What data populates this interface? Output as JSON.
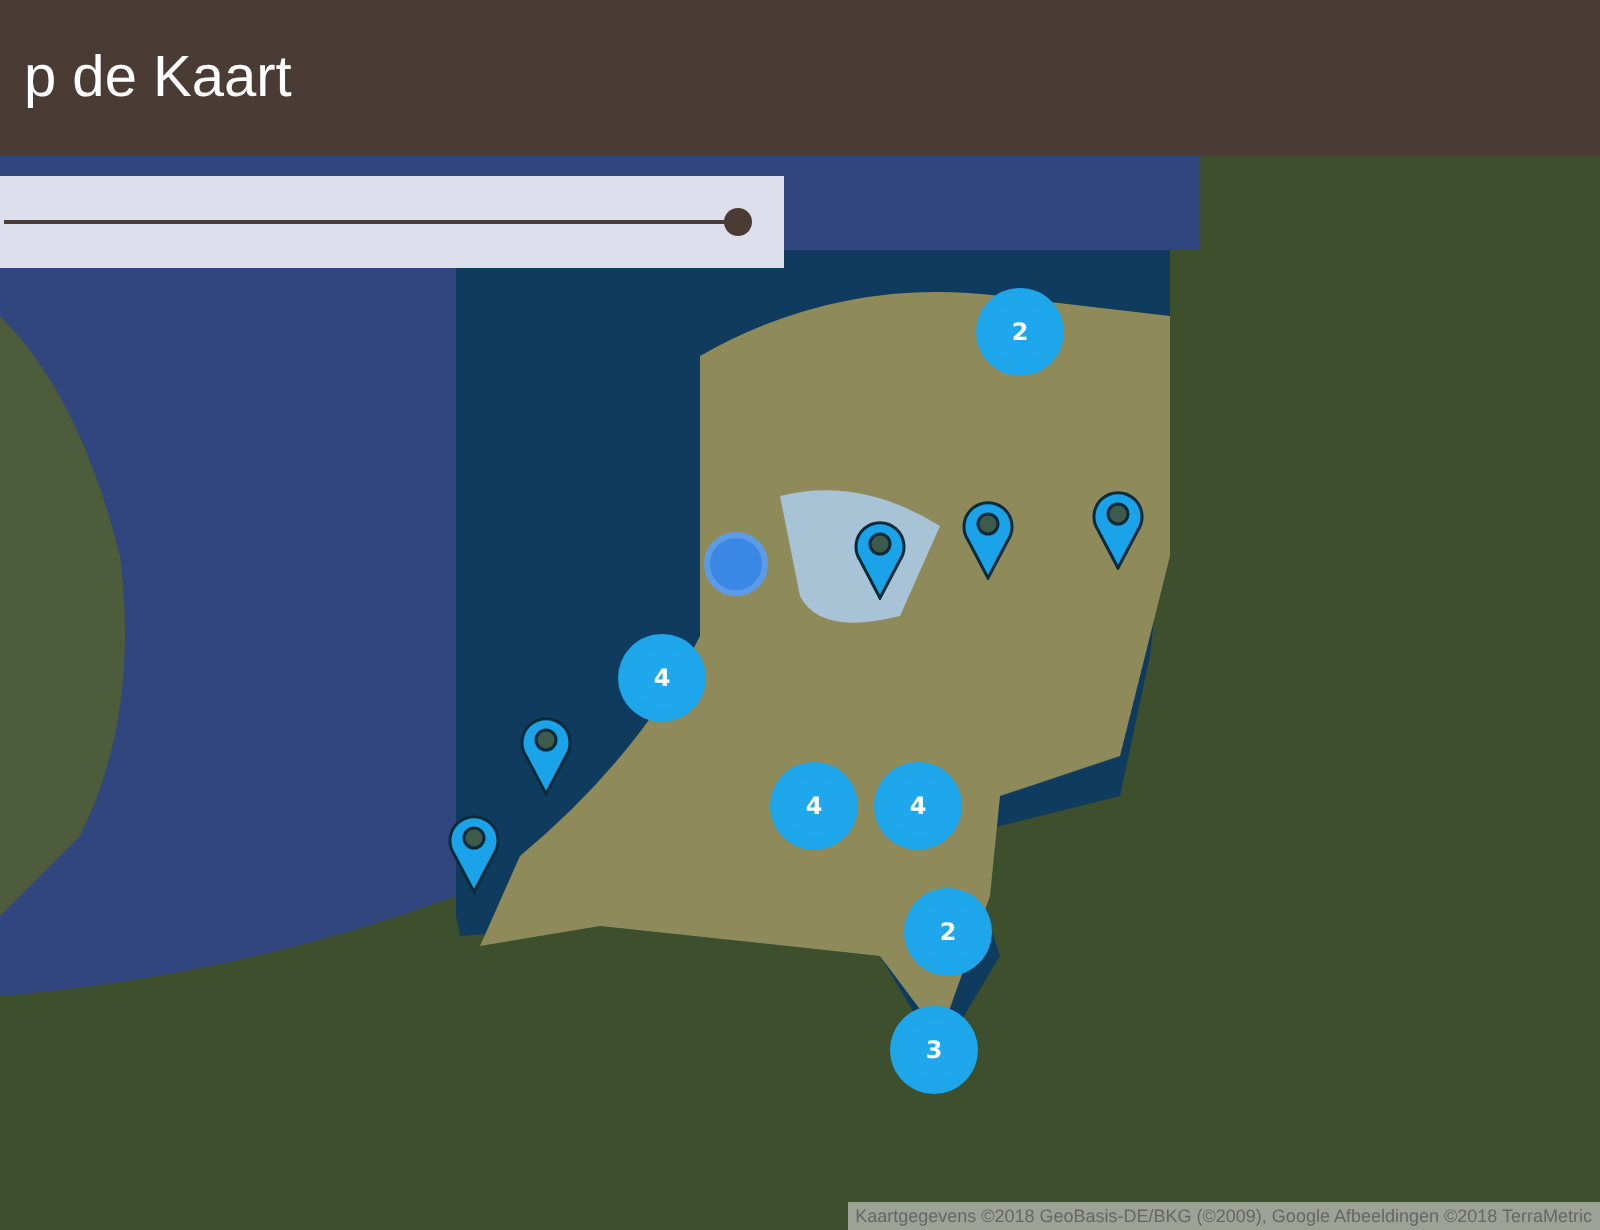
{
  "header": {
    "title": "p de Kaart"
  },
  "filter_slider": {
    "level": 1.0
  },
  "map": {
    "markers": [
      {
        "kind": "cluster",
        "count": "2"
      },
      {
        "kind": "location"
      },
      {
        "kind": "pin"
      },
      {
        "kind": "pin"
      },
      {
        "kind": "pin"
      },
      {
        "kind": "cluster",
        "count": "4"
      },
      {
        "kind": "pin"
      },
      {
        "kind": "cluster",
        "count": "4"
      },
      {
        "kind": "cluster",
        "count": "4"
      },
      {
        "kind": "pin"
      },
      {
        "kind": "cluster",
        "count": "2"
      },
      {
        "kind": "cluster",
        "count": "3"
      }
    ],
    "attribution": "Kaartgegevens ©2018 GeoBasis-DE/BKG (©2009), Google Afbeeldingen ©2018 TerraMetric"
  }
}
